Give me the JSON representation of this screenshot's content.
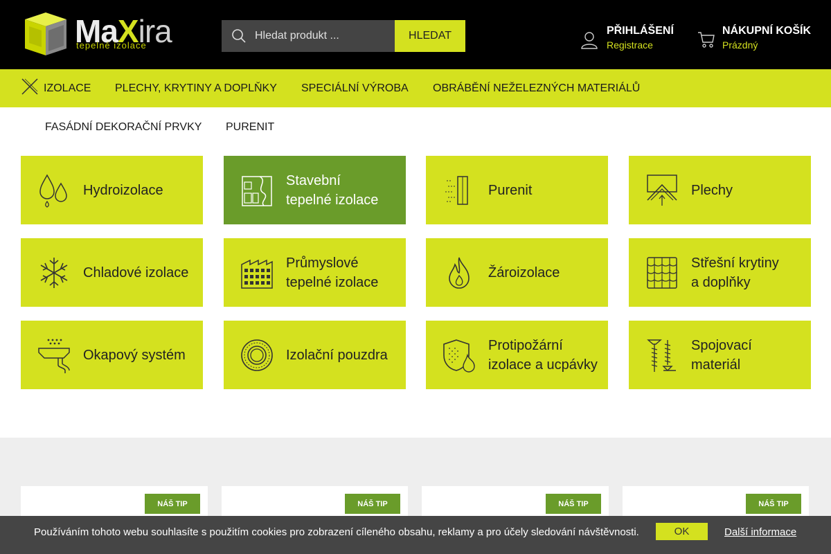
{
  "header": {
    "logo": {
      "main": "MaXira",
      "tagline": "tepelné izolace"
    },
    "search": {
      "placeholder": "Hledat produkt ...",
      "button_label": "HLEDAT"
    },
    "account": {
      "title": "PŘIHLÁŠENÍ",
      "link": "Registrace"
    },
    "cart": {
      "title": "NÁKUPNÍ KOŠÍK",
      "status": "Prázdný"
    }
  },
  "nav": {
    "items": [
      "IZOLACE",
      "PLECHY, KRYTINY A DOPLŇKY",
      "SPECIÁLNÍ VÝROBA",
      "OBRÁBĚNÍ NEŽELEZNÝCH MATERIÁLŮ"
    ],
    "sub_items": [
      "FASÁDNÍ DEKORAČNÍ PRVKY",
      "PURENIT"
    ]
  },
  "categories": [
    {
      "label": "Hydroizolace",
      "icon": "water-drops-icon"
    },
    {
      "label": "Stavební\ntepelné izolace",
      "icon": "building-insulation-icon",
      "active": true
    },
    {
      "label": "Purenit",
      "icon": "purenit-panel-icon"
    },
    {
      "label": "Plechy",
      "icon": "sheet-metal-icon"
    },
    {
      "label": "Chladové izolace",
      "icon": "snowflake-icon"
    },
    {
      "label": "Průmyslové\ntepelné izolace",
      "icon": "factory-icon"
    },
    {
      "label": "Žároizolace",
      "icon": "flame-icon"
    },
    {
      "label": "Střešní krytiny\na doplňky",
      "icon": "roof-tiles-icon"
    },
    {
      "label": "Okapový systém",
      "icon": "gutter-icon"
    },
    {
      "label": "Izolační pouzdra",
      "icon": "pipe-section-icon"
    },
    {
      "label": "Protipožární\nizolace a ucpávky",
      "icon": "fire-shield-icon"
    },
    {
      "label": "Spojovací\nmateriál",
      "icon": "screws-icon"
    }
  ],
  "products": {
    "badge": "NÁŠ TIP",
    "cards": [
      {
        "badge": "NÁŠ TIP"
      },
      {
        "badge": "NÁŠ TIP"
      },
      {
        "badge": "NÁŠ TIP"
      },
      {
        "badge": "NÁŠ TIP"
      }
    ]
  },
  "cookie": {
    "text": "Používáním tohoto webu souhlasíte s použitím cookies pro zobrazení cíleného obsahu, reklamy a pro účely sledování návštěvnosti.",
    "ok": "OK",
    "more": "Další informace"
  },
  "colors": {
    "accent": "#d4e11f",
    "active": "#6a9c2a",
    "header_bg": "#000000",
    "cookie_bg": "#454545"
  }
}
